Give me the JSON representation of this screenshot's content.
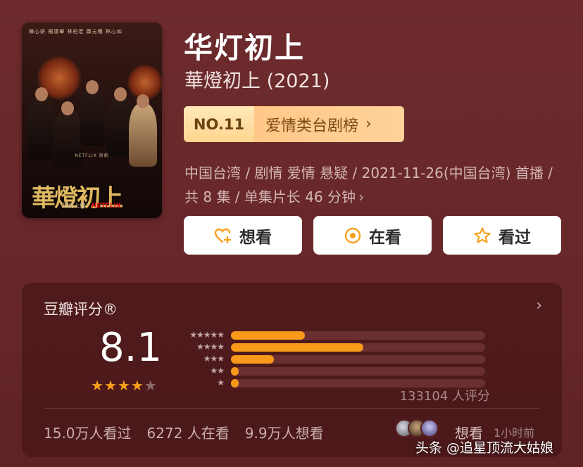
{
  "poster": {
    "names": "陳心妍  楊謹華  林柏宏  鄭元暢  林心如",
    "netflix_line": "NETFLIX 原創",
    "title_art": "華燈初上",
    "release_note": "即將上線",
    "brand": "NETFLIX"
  },
  "show": {
    "title": "华灯初上",
    "original_title": "華燈初上 (2021)"
  },
  "rank": {
    "number": "NO.11",
    "list_name": "爱情类台剧榜",
    "chevron": "›"
  },
  "meta": {
    "text": "中国台湾 / 剧情 爱情 悬疑 / 2021-11-26(中国台湾) 首播 / 共 8 集 / 单集片长 46 分钟",
    "chevron": "›"
  },
  "actions": {
    "want_label": "想看",
    "watching_label": "在看",
    "watched_label": "看过"
  },
  "rating": {
    "title": "豆瓣评分®",
    "chevron": "›",
    "score": "8.1",
    "stars_filled": 4,
    "stars_total": 5,
    "distribution": [
      {
        "stars": "★★★★★",
        "fraction": 0.29
      },
      {
        "stars": "★★★★",
        "fraction": 0.52
      },
      {
        "stars": "★★★",
        "fraction": 0.17
      },
      {
        "stars": "★★",
        "fraction": 0.03
      },
      {
        "stars": "★",
        "fraction": 0.03
      }
    ],
    "votes": "133104 人评分"
  },
  "stats": {
    "watched": "15.0万人看过",
    "watching": "6272 人在看",
    "want": "9.9万人想看"
  },
  "activity": {
    "action": "想看",
    "time": "1小时前"
  },
  "watermark": {
    "text": "头条 @追星顶流大姑娘"
  },
  "colors": {
    "background": "#6b2a2c",
    "accent_orange": "#f79a1a",
    "rank_bg": "#ffd29a",
    "button_bg": "#ffffff"
  }
}
